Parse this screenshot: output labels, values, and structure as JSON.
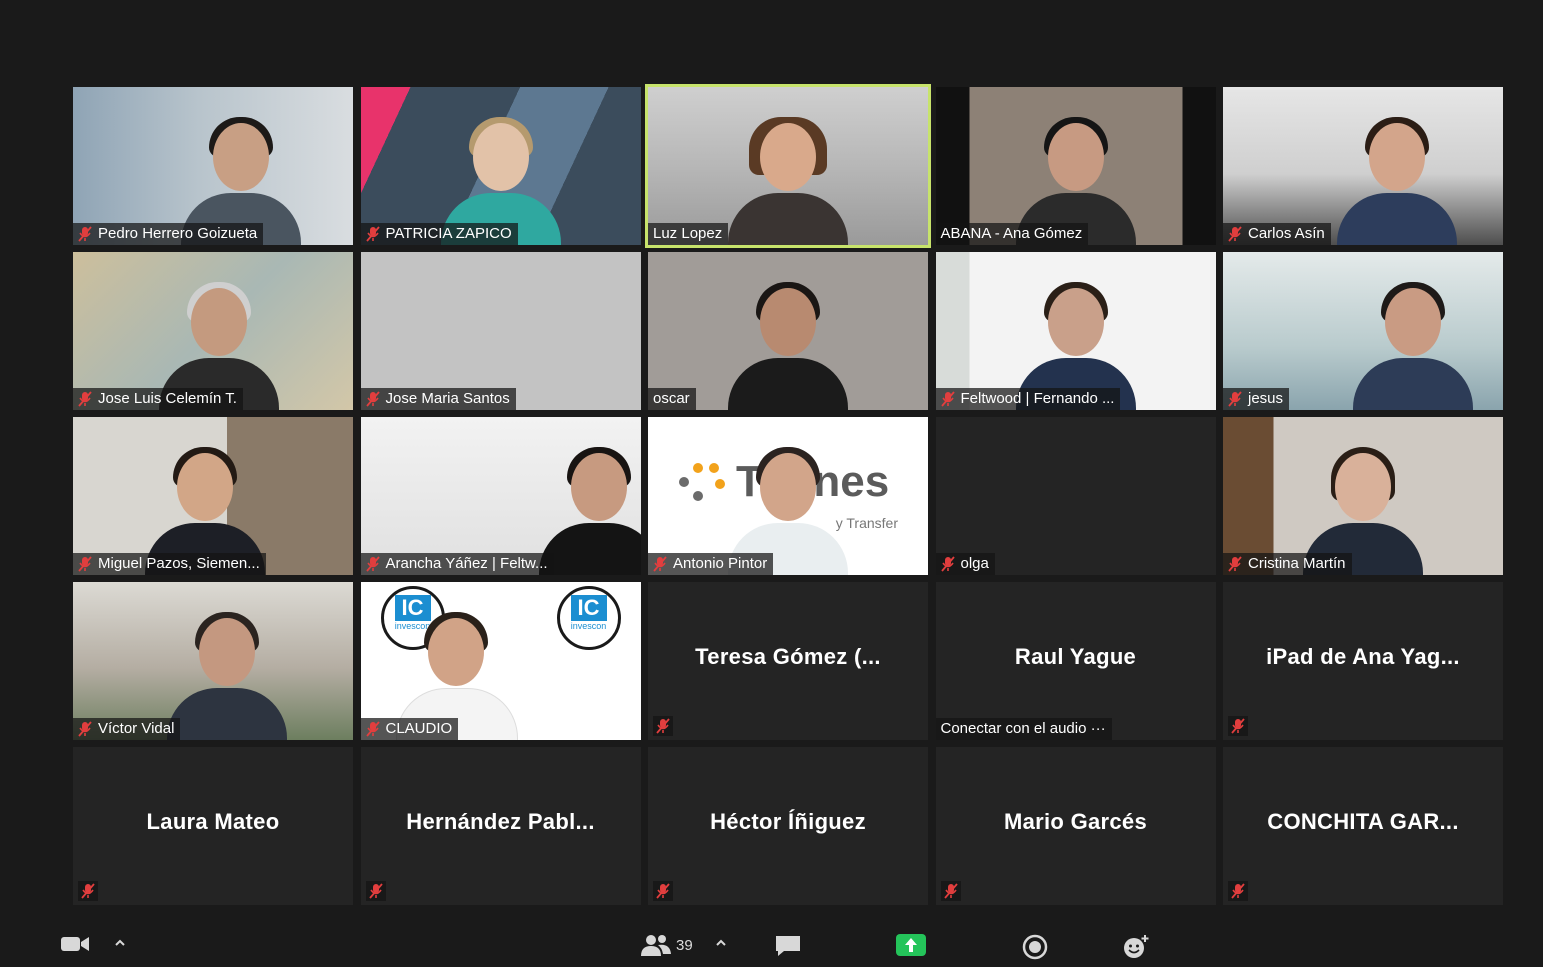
{
  "colors": {
    "background": "#1a1a1a",
    "tile": "#242424",
    "active_border": "#c7e36b",
    "muted_icon": "#e23e3e",
    "share_green": "#24c45a"
  },
  "participants": [
    {
      "name": "Pedro Herrero Goizueta",
      "muted": true,
      "video": true
    },
    {
      "name": "PATRICIA ZAPICO",
      "muted": true,
      "video": true
    },
    {
      "name": "Luz Lopez",
      "muted": false,
      "video": true,
      "active_speaker": true
    },
    {
      "name": "ABANA - Ana Gómez",
      "muted": false,
      "video": true
    },
    {
      "name": "Carlos Asín",
      "muted": true,
      "video": true
    },
    {
      "name": "Jose Luis Celemín T.",
      "muted": true,
      "video": true
    },
    {
      "name": "Jose Maria Santos",
      "muted": true,
      "video": true
    },
    {
      "name": "oscar",
      "muted": false,
      "video": true
    },
    {
      "name": "Feltwood | Fernando ...",
      "muted": true,
      "video": true
    },
    {
      "name": "jesus",
      "muted": true,
      "video": true
    },
    {
      "name": "Miguel Pazos, Siemen...",
      "muted": true,
      "video": true
    },
    {
      "name": "Arancha Yáñez | Feltw...",
      "muted": true,
      "video": true
    },
    {
      "name": "Antonio Pintor",
      "muted": true,
      "video": true,
      "bg_text": "Titanes",
      "bg_subtext": "y Transfer"
    },
    {
      "name": "olga",
      "muted": true,
      "video": false,
      "show_tag": true
    },
    {
      "name": "Cristina Martín",
      "muted": true,
      "video": true
    },
    {
      "name": "Víctor Vidal",
      "muted": true,
      "video": true
    },
    {
      "name": "CLAUDIO",
      "muted": true,
      "video": true,
      "logo_text": "invescon"
    },
    {
      "name": "Teresa Gómez (...",
      "muted": true,
      "video": false
    },
    {
      "name": "Raul Yague",
      "muted": false,
      "video": false,
      "status": "Conectar con el audio ···"
    },
    {
      "name": "iPad de Ana Yag...",
      "muted": true,
      "video": false
    },
    {
      "name": "Laura Mateo",
      "muted": true,
      "video": false
    },
    {
      "name": "Hernández Pabl...",
      "muted": true,
      "video": false
    },
    {
      "name": "Héctor Íñiguez",
      "muted": true,
      "video": false
    },
    {
      "name": "Mario Garcés",
      "muted": true,
      "video": false
    },
    {
      "name": "CONCHITA GAR...",
      "muted": true,
      "video": false
    }
  ],
  "toolbar": {
    "participant_count": "39",
    "icons": [
      "video-camera-icon",
      "chevron-up-icon",
      "participants-icon",
      "chevron-up-icon",
      "chat-icon",
      "share-screen-icon",
      "record-icon",
      "reactions-icon"
    ]
  }
}
